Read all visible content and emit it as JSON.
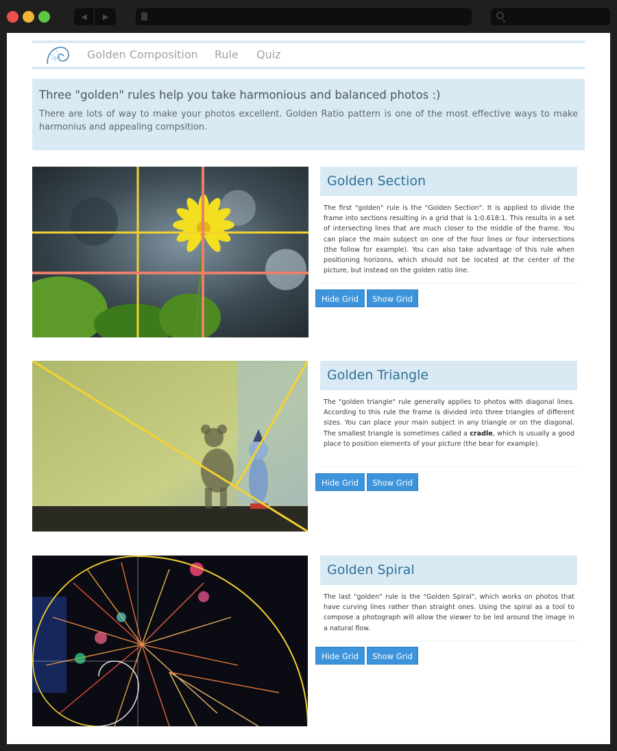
{
  "nav": {
    "links": [
      "Golden Composition",
      "Rule",
      "Quiz"
    ]
  },
  "hero": {
    "title": "Three \"golden\" rules help you take harmonious and balanced photos :)",
    "body": "There are lots of way to make your photos excellent. Golden Ratio pattern is one of the most effective ways to make harmonius and appealing compsition."
  },
  "sections": [
    {
      "title": "Golden Section",
      "body": "The first \"golden\" rule is the \"Golden Section\". It is applied to divide the frame into sections resulting in a grid that is 1:0.618:1. This results in a set of intersecting lines that are much closer to the middle of the frame. You can place the main subject on one of the four lines or four intersections (the follow for example). You can also take advantage of this rule when positioning horizons, which should not be located at the center of the picture, but instead on the golden ratio line.",
      "hide_label": "Hide Grid",
      "show_label": "Show Grid"
    },
    {
      "title": "Golden Triangle",
      "body_before": "The \"golden triangle\" rule generally applies to photos with diagonal lines. According to this rule the frame is divided into three triangles of different sizes. You can place your main subject in any triangle or on the diagonal. The smallest triangle is sometimes called a ",
      "body_bold": "cradle",
      "body_after": ", which is usually a good place to position elements of your picture (the bear for example).",
      "hide_label": "Hide Grid",
      "show_label": "Show Grid"
    },
    {
      "title": "Golden Spiral",
      "body": "The last \"golden\" rule is the \"Golden Spiral\", which works on photos that have curving lines rather than straight ones. Using the spiral as a tool to compose a photograph will allow the viewer to be led around the image in a natural flow.",
      "hide_label": "Hide Grid",
      "show_label": "Show Grid"
    }
  ],
  "colors": {
    "accent": "#3d94da",
    "panel": "#d9eaf5",
    "title_text": "#2f6f93",
    "grid_yellow": "#f5d22e",
    "grid_red": "#e8806a"
  },
  "icons": {
    "logo": "golden-spiral-logo",
    "back": "back-arrow-icon",
    "forward": "forward-arrow-icon",
    "page": "document-icon",
    "search": "search-icon"
  }
}
